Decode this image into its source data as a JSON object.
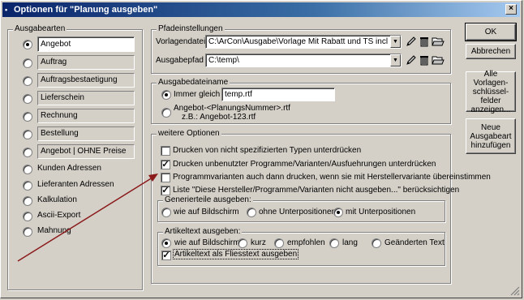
{
  "window": {
    "title": "Optionen für \"Planung ausgeben\"",
    "close_label": "×"
  },
  "ausgabearten": {
    "legend": "Ausgabearten",
    "doc_types": [
      "Angebot",
      "Auftrag",
      "Auftragsbestaetigung",
      "Lieferschein",
      "Rechnung",
      "Bestellung",
      "Angebot | OHNE Preise"
    ],
    "others": [
      "Kunden Adressen",
      "Lieferanten Adressen",
      "Kalkulation",
      "Ascii-Export",
      "Mahnung"
    ]
  },
  "pfade": {
    "legend": "Pfadeinstellungen",
    "vorlage_label": "Vorlagendatei",
    "vorlage_value": "C:\\ArCon\\Ausgabe\\Vorlage Mit Rabatt und TS incl MwSt.rtf",
    "ausgabe_label": "Ausgabepfad",
    "ausgabe_value": "C:\\temp\\"
  },
  "dateiname": {
    "legend": "Ausgabedateiname",
    "opt1": "Immer gleich",
    "opt1_value": "temp.rtf",
    "opt2_line1": "Angebot-<PlanungsNummer>.rtf",
    "opt2_line2": "z.B.: Angebot-123.rtf"
  },
  "optionen": {
    "legend": "weitere Optionen",
    "checks": [
      "Drucken von nicht spezifizierten Typen unterdrücken",
      "Drucken unbenutzter Programme/Varianten/Ausfuehrungen unterdrücken",
      "Programmvarianten auch dann drucken, wenn sie mit Herstellervariante übereinstimmen",
      "Liste \"Diese Hersteller/Programme/Varianten nicht ausgeben...\" berücksichtigen"
    ],
    "generiert": {
      "legend": "Generierteile ausgeben:",
      "options": [
        "wie auf Bildschirm",
        "ohne Unterpositionen",
        "mit Unterpositionen"
      ]
    },
    "artikeltext": {
      "legend": "Artikeltext ausgeben:",
      "options": [
        "wie auf Bildschirm",
        "kurz",
        "empfohlen",
        "lang",
        "Geänderten Text"
      ],
      "fliess": "Artikeltext als Fliesstext ausgeben"
    }
  },
  "buttons": {
    "ok": "OK",
    "abbrechen": "Abbrechen",
    "vorlagen": "Alle Vorlagen-\nschlüssel-\nfelder\nanzeigen...",
    "neue": "Neue\nAusgabeart\nhinzufügen"
  },
  "colors": {
    "arrow": "#8b1a1a",
    "titlebar": "#0a246a"
  }
}
